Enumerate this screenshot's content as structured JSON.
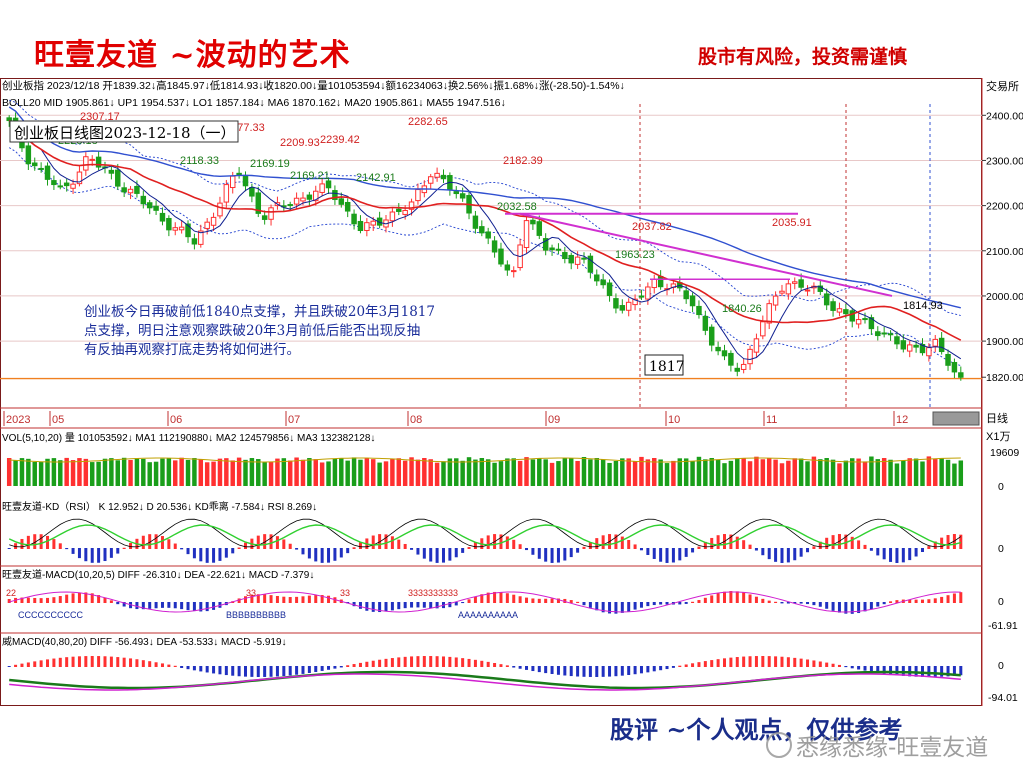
{
  "header": {
    "brand": "旺壹友道 ~波动的艺术",
    "risk_notice": "股市有风险，投资需谨慎"
  },
  "footer": {
    "caption": "股评 ~个人观点，仅供参考",
    "watermark": "悉缘悉缘-旺壹友道"
  },
  "colors": {
    "up": "#ff3030",
    "down": "#1a9e1a",
    "mid": "#e02020",
    "ma5": "#3050d0",
    "ma55": "#d020d0",
    "bollband": "#2040d0",
    "support": "#f08020",
    "trend": "#d030d0"
  },
  "chart_data": {
    "type": "candlestick",
    "info_line": "创业板指 2023/12/18 开1839.32↓高1845.97↓低1814.93↓收1820.00↓量101053594↓额16234063↓换2.56%↓振1.68%↓涨(-28.50)-1.54%↓",
    "indicator_line": "BOLL20  MID 1905.861↓  UP1 1954.537↓  LO1 1857.184↓  MA6 1870.162↓  MA20 1905.861↓  MA55 1947.516↓",
    "title_box": "创业板日线图2023-12-18（一）",
    "price_axis_label": "交易所",
    "y_ticks": [
      "2400.00",
      "2300.00",
      "2200.00",
      "2100.00",
      "2000.00",
      "1900.00",
      "1820.00"
    ],
    "ylim": [
      1805,
      2425
    ],
    "months": [
      "2023",
      "05",
      "06",
      "07",
      "08",
      "09",
      "10",
      "11",
      "12"
    ],
    "date_label": "日线",
    "current_price_label": "1820.00",
    "price_labels": [
      "2307.17",
      "2228.18",
      "2118.33",
      "2277.33",
      "2169.19",
      "2209.93",
      "2239.42",
      "2169.21",
      "2142.91",
      "2282.65",
      "2182.39",
      "2032.58",
      "1963.23",
      "2037.82",
      "1840.26",
      "2035.91",
      "1814.93"
    ],
    "support_level_label": "1817",
    "support_level": 1817,
    "annotation": [
      "创业板今日再破前低1840点支撑，并且跌破20年3月1817",
      "点支撑，明日注意观察跌破20年3月前低后能否出现反抽",
      "有反抽再观察打底走势将如何进行。"
    ],
    "volume": {
      "header": "VOL(5,10,20)  量 101053592↓  MA1 112190880↓  MA2 124579856↓  MA3 132382128↓",
      "unit": "X1万",
      "ticks": [
        "19609",
        "0"
      ]
    },
    "kd": {
      "header": "旺壹友道-KD（RSI）  K 12.952↓  D 20.536↓  KD乖离 -7.584↓  RSI 8.269↓",
      "ticks": [
        "0"
      ]
    },
    "macd": {
      "header": "旺壹友道-MACD(10,20,5)  DIFF -26.310↓  DEA -22.621↓  MACD -7.379↓",
      "ticks": [
        "0",
        "-61.91"
      ],
      "markers": [
        "22",
        "33",
        "33",
        "3333333333",
        "AAAAAAAAAA",
        "BBBBBBBBBB",
        "CCCCCCCCCC"
      ]
    },
    "wmacd": {
      "header": "威MACD(40,80,20)  DIFF -56.493↓  DEA -53.533↓  MACD -5.919↓",
      "ticks": [
        "0",
        "-94.01"
      ]
    }
  }
}
